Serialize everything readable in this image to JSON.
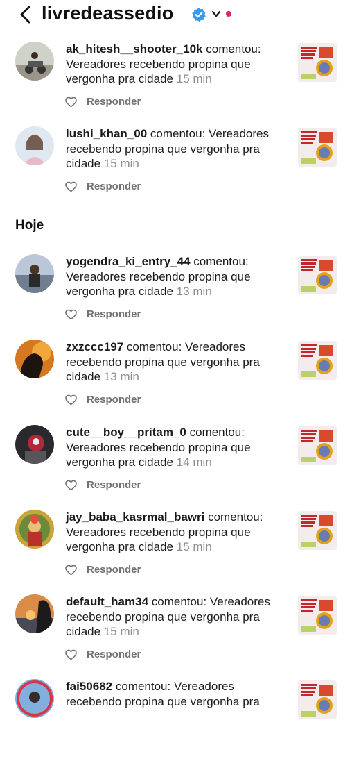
{
  "header": {
    "title": "livredeassedio"
  },
  "section_today": "Hoje",
  "commented": "comentou:",
  "comment_text": "Vereadores recebendo propina que vergonha pra cidade",
  "reply_label": "Responder",
  "colors": {
    "verified": "#3897f0",
    "dot": "#e0245e",
    "muted": "#8e8e8e"
  },
  "notifications": [
    {
      "user": "ak_hitesh__shooter_10k",
      "comment": "Vereadores recebendo propina que vergonha pra cidade",
      "time": "15 min"
    },
    {
      "user": "lushi_khan_00",
      "comment": "Vereadores recebendo propina que vergonha pra cidade",
      "time": "15 min"
    },
    {
      "user": "yogendra_ki_entry_44",
      "comment": "Vereadores recebendo propina que vergonha pra cidade",
      "time": "13 min"
    },
    {
      "user": "zxzccc197",
      "comment": "Vereadores recebendo propina que vergonha pra cidade",
      "time": "13 min"
    },
    {
      "user": "cute__boy__pritam_0",
      "comment": "Vereadores recebendo propina que vergonha pra cidade",
      "time": "14 min"
    },
    {
      "user": "jay_baba_kasrmal_bawri",
      "comment": "Vereadores recebendo propina que vergonha pra cidade",
      "time": "15 min"
    },
    {
      "user": "default_ham34",
      "comment": "Vereadores recebendo propina que vergonha pra cidade",
      "time": "15 min"
    },
    {
      "user": "fai50682",
      "comment": "Vereadores recebendo propina que vergonha pra",
      "time": ""
    }
  ]
}
